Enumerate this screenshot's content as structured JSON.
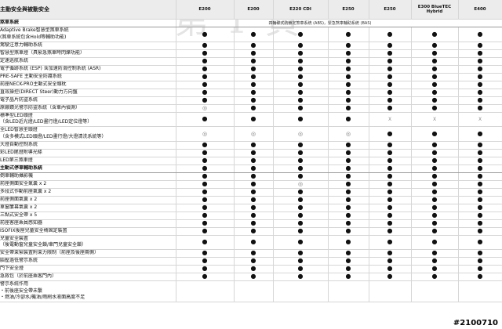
{
  "watermark": "第 1 頁",
  "stamp": "#2100710",
  "header": {
    "feature_title": "主動安全與被動安全",
    "models": [
      "E200",
      "E200",
      "E220 CDI",
      "E250",
      "E250",
      "E300 BlueTEC Hybrid",
      "E400"
    ]
  },
  "abs_note": "四輪碟式防鎖定煞車系統 (ABS)，緊急煞車輔助系統 (BAS)",
  "legend": {
    "standard": "●",
    "optional": "◎",
    "unavailable": "X"
  },
  "rows": [
    {
      "label": [
        "煞車系統"
      ],
      "section": true,
      "cells": [
        "",
        "",
        "",
        "",
        "",
        "",
        ""
      ]
    },
    {
      "label": [
        "Adaptive Brake智慧型煞車系統",
        "(煞車系統包含Hold等輔助功能)"
      ],
      "cells": [
        "●",
        "●",
        "●",
        "●",
        "●",
        "●",
        "●"
      ]
    },
    {
      "label": [
        "駕駛注意力輔助系統"
      ],
      "cells": [
        "●",
        "●",
        "●",
        "●",
        "●",
        "●",
        "●"
      ]
    },
    {
      "label": [
        "智慧型煞車燈（具緊急煞車時閃爍功能）"
      ],
      "cells": [
        "●",
        "●",
        "●",
        "●",
        "●",
        "●",
        "●"
      ]
    },
    {
      "label": [
        "定速巡航系統"
      ],
      "cells": [
        "●",
        "●",
        "●",
        "●",
        "●",
        "●",
        "●"
      ]
    },
    {
      "label": [
        "電子循跡系統 (ESP) 含加速防滑控制系統 (ASR)"
      ],
      "cells": [
        "●",
        "●",
        "●",
        "●",
        "●",
        "●",
        "●"
      ]
    },
    {
      "label": [
        "PRE-SAFE 主動安全防護系統"
      ],
      "cells": [
        "●",
        "●",
        "●",
        "●",
        "●",
        "●",
        "●"
      ]
    },
    {
      "label": [
        "前座NECK-PRO主動式安全頭枕"
      ],
      "cells": [
        "●",
        "●",
        "●",
        "●",
        "●",
        "●",
        "●"
      ]
    },
    {
      "label": [
        "直效操控(DIRECT Steer)動力方向盤"
      ],
      "cells": [
        "●",
        "●",
        "●",
        "●",
        "●",
        "●",
        "●"
      ]
    },
    {
      "label": [
        "電子晶片防盜系統"
      ],
      "cells": [
        "●",
        "●",
        "●",
        "●",
        "●",
        "●",
        "●"
      ]
    },
    {
      "label": [
        "原廠鑽光警示防盜系統（含車內偵測）"
      ],
      "cells": [
        "◎",
        "●",
        "●",
        "●",
        "●",
        "●",
        "●"
      ]
    },
    {
      "label": [
        "標準型LED頭燈",
        "（含LED近光燈/LED畫行燈/LED定位燈等）"
      ],
      "cells": [
        "●",
        "●",
        "●",
        "●",
        "X",
        "X",
        "X"
      ]
    },
    {
      "label": [
        "全LED智慧型頭燈",
        "（含多模式LED頭燈/LED畫行燈/大燈清洗系統等）"
      ],
      "cells": [
        "◎",
        "◎",
        "◎",
        "◎",
        "●",
        "●",
        "●"
      ]
    },
    {
      "label": [
        "大燈自動控制系統"
      ],
      "cells": [
        "●",
        "●",
        "●",
        "●",
        "●",
        "●",
        "●"
      ]
    },
    {
      "label": [
        "彩LED尾燈附導光條"
      ],
      "cells": [
        "●",
        "●",
        "●",
        "●",
        "●",
        "●",
        "●"
      ]
    },
    {
      "label": [
        "LED第三煞車燈"
      ],
      "cells": [
        "●",
        "●",
        "●",
        "●",
        "●",
        "●",
        "●"
      ]
    },
    {
      "label": [
        "主動式停車輔助系統"
      ],
      "section": true,
      "cells": [
        "●",
        "●",
        "●",
        "●",
        "●",
        "●",
        "●"
      ]
    },
    {
      "label": [
        "倒車輔助攝影機"
      ],
      "cells": [
        "●",
        "●",
        "●",
        "●",
        "●",
        "●",
        "●"
      ]
    },
    {
      "label": [
        "前座側面安全氣囊 x 2"
      ],
      "cells": [
        "●",
        "●",
        "◎",
        "●",
        "●",
        "●",
        "●"
      ]
    },
    {
      "label": [
        "多段式作動前座氣囊 x 2"
      ],
      "cells": [
        "●",
        "●",
        "●",
        "●",
        "●",
        "●",
        "●"
      ]
    },
    {
      "label": [
        "前座側面氣囊 x 2"
      ],
      "cells": [
        "●",
        "●",
        "●",
        "●",
        "●",
        "●",
        "●"
      ]
    },
    {
      "label": [
        "車窗簾幕氣囊 x 2"
      ],
      "cells": [
        "●",
        "●",
        "●",
        "●",
        "●",
        "●",
        "●"
      ]
    },
    {
      "label": [
        "三點式安全帶 x 5"
      ],
      "cells": [
        "●",
        "●",
        "●",
        "●",
        "●",
        "●",
        "●"
      ]
    },
    {
      "label": [
        "前座客座乘員感知器"
      ],
      "cells": [
        "●",
        "●",
        "●",
        "●",
        "●",
        "●",
        "●"
      ]
    },
    {
      "label": [
        "ISOFIX後座兒童安全椅固定裝置"
      ],
      "cells": [
        "●",
        "●",
        "●",
        "●",
        "●",
        "●",
        "●"
      ]
    },
    {
      "label": [
        "兒童安全裝置",
        "（後電動窗兒童安全鎖/車門兒童安全鎖）"
      ],
      "cells": [
        "●",
        "●",
        "●",
        "●",
        "●",
        "●",
        "●"
      ]
    },
    {
      "label": [
        "安全帶束緊裝置附束力限制（前座及後座兩側）"
      ],
      "cells": [
        "●",
        "●",
        "●",
        "●",
        "●",
        "●",
        "●"
      ]
    },
    {
      "label": [
        "胎壓過低警示系統"
      ],
      "cells": [
        "●",
        "●",
        "●",
        "●",
        "●",
        "●",
        "●"
      ]
    },
    {
      "label": [
        "門下安全燈"
      ],
      "cells": [
        "●",
        "●",
        "●",
        "●",
        "●",
        "●",
        "●"
      ]
    },
    {
      "label": [
        "急救包（於前座乘客門內）"
      ],
      "cells": [
        "●",
        "●",
        "●",
        "●",
        "●",
        "●",
        "●"
      ]
    },
    {
      "label": [
        "警示系統作用",
        "・前後座安全帶未繫",
        "・燃油/冷卻水/機油/雨刷水液面高度不足"
      ],
      "cells": [
        "",
        "",
        "",
        "",
        "",
        "",
        ""
      ]
    }
  ]
}
